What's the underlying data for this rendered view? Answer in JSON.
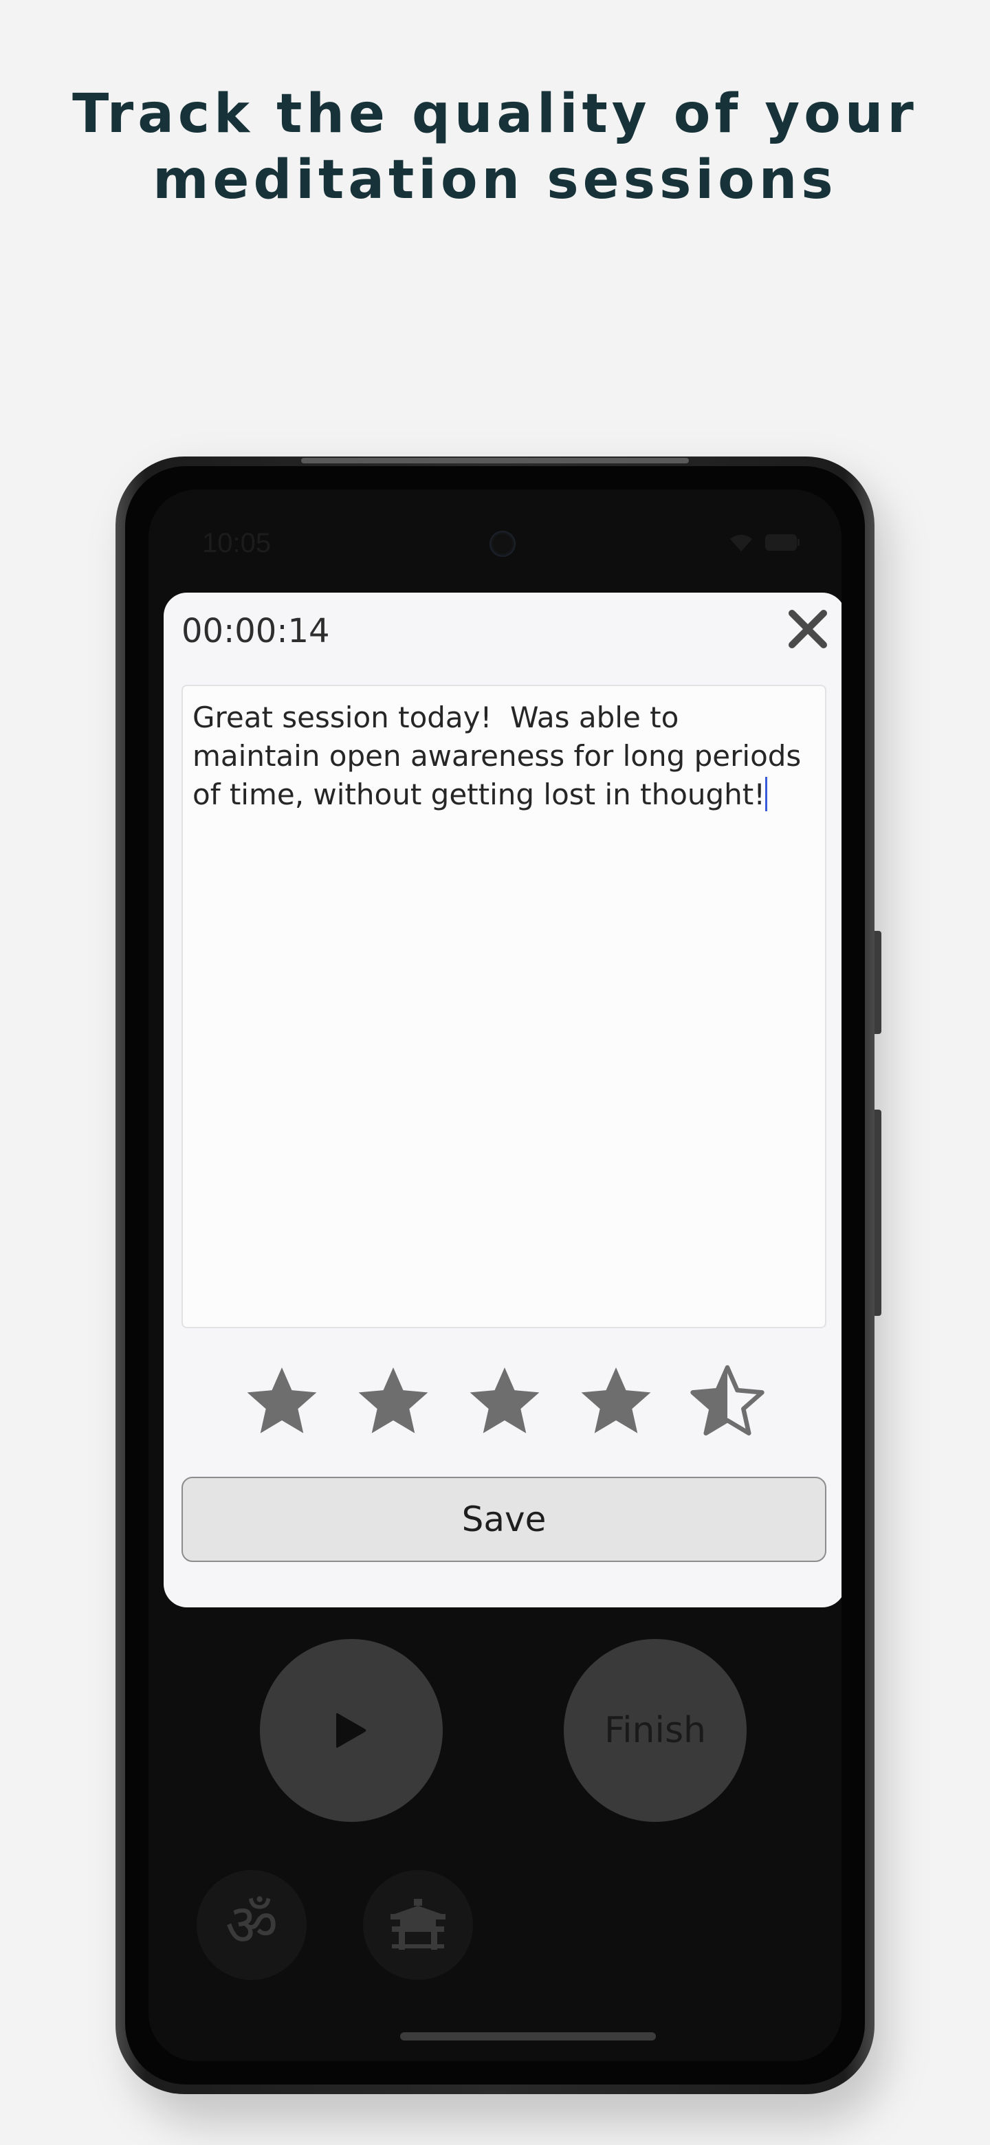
{
  "headline": {
    "line1": "Track the quality of your",
    "line2": "meditation sessions"
  },
  "statusbar": {
    "time": "10:05",
    "icons": [
      "wifi-icon",
      "battery-icon"
    ]
  },
  "modal": {
    "timer": "00:00:14",
    "close_icon": "close-icon",
    "notes_text": "Great session today!  Was able to maintain open awareness for long periods of time, without getting lost in thought!",
    "rating": 4.5,
    "rating_max": 5,
    "save_label": "Save"
  },
  "controls": {
    "play_icon": "play-icon",
    "finish_label": "Finish",
    "om_icon": "om-icon",
    "om_glyph": "ॐ",
    "temple_icon": "temple-icon"
  },
  "colors": {
    "page_background": "#f3f3f3",
    "headline": "#173238",
    "star_fill": "#6e6e6e",
    "caret": "#3a5bd9"
  }
}
